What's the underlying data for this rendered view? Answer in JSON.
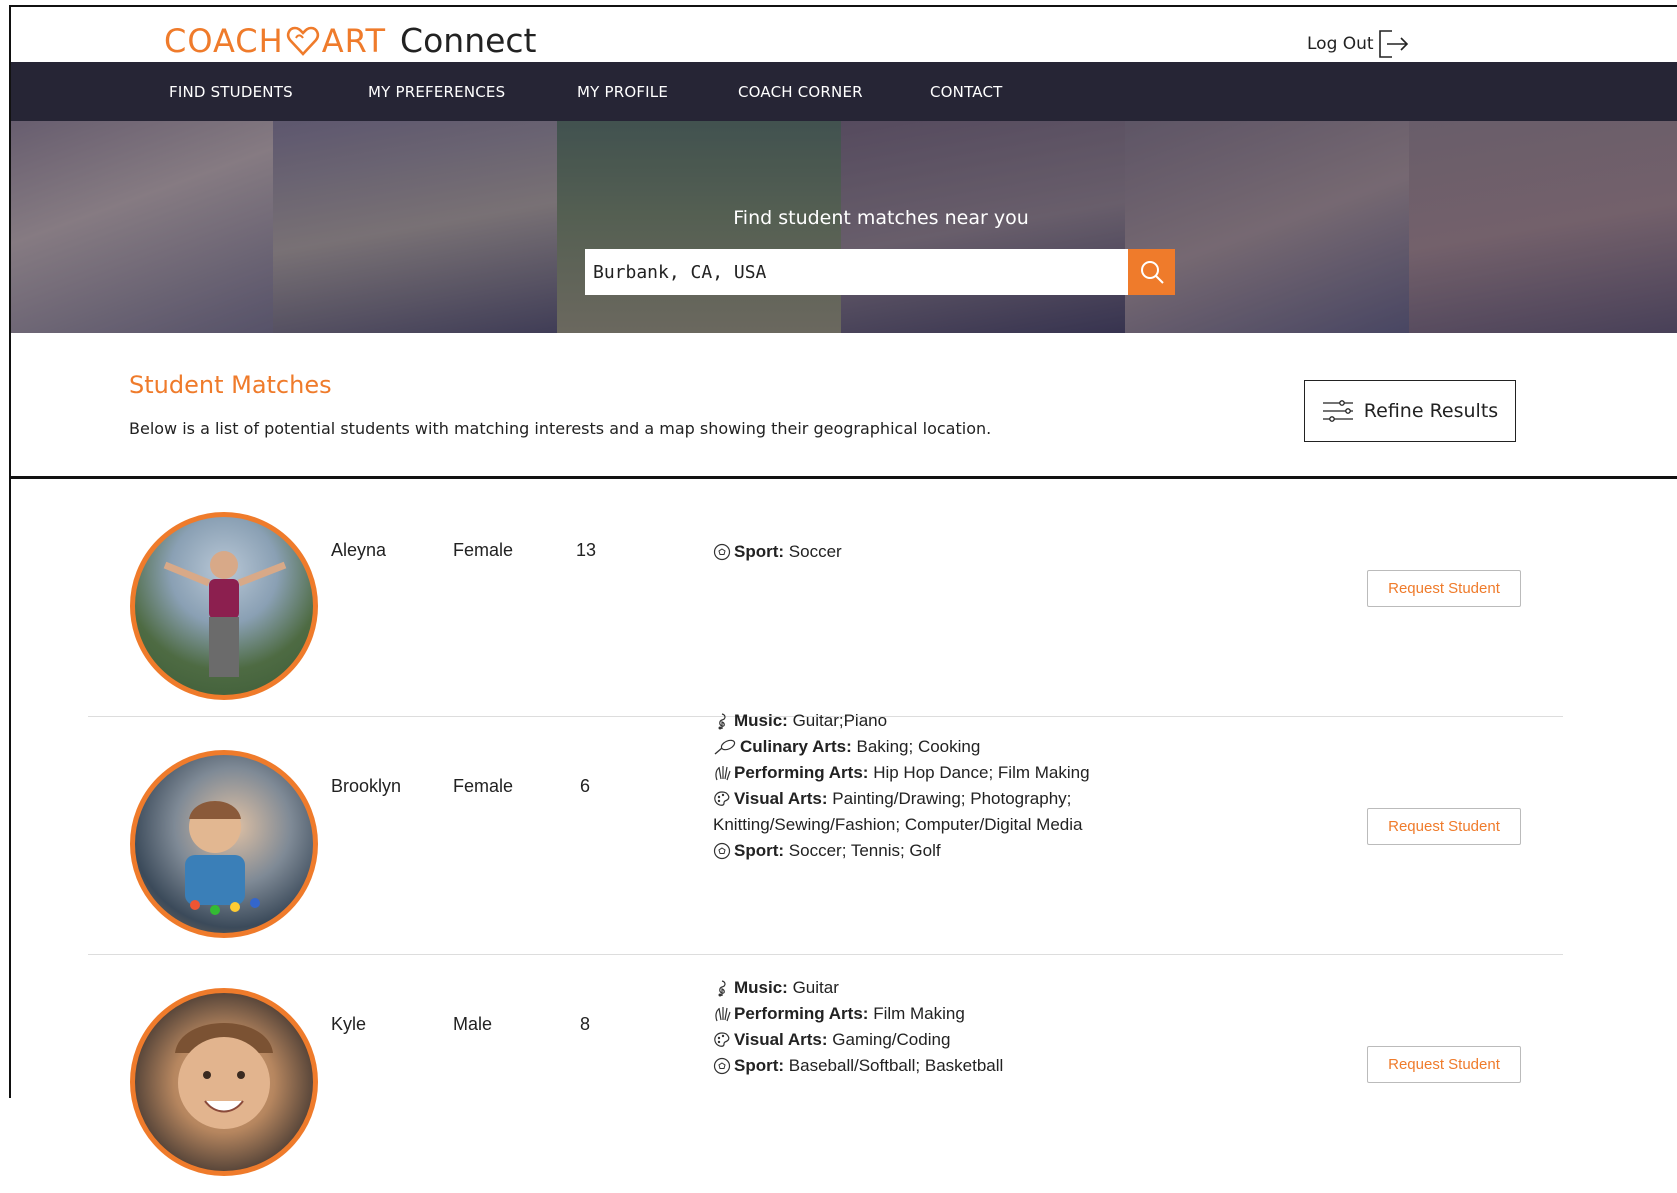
{
  "brand": {
    "logo_left": "COACH",
    "logo_right": "ART",
    "product": "Connect",
    "accent_color": "#ef7b2b",
    "nav_bg": "#262535"
  },
  "header": {
    "logout_label": "Log Out",
    "logout_icon": "logout-icon"
  },
  "nav": {
    "items": [
      {
        "label": "FIND STUDENTS"
      },
      {
        "label": "MY PREFERENCES"
      },
      {
        "label": "MY PROFILE"
      },
      {
        "label": "COACH CORNER"
      },
      {
        "label": "CONTACT"
      }
    ]
  },
  "hero": {
    "title": "Find student matches near you",
    "search_value": "Burbank, CA, USA",
    "search_icon": "search-icon"
  },
  "matches": {
    "title": "Student Matches",
    "description": "Below is a list of potential students with matching interests and a map showing their geographical location.",
    "refine_label": "Refine Results",
    "refine_icon": "sliders-icon"
  },
  "students": [
    {
      "name": "Aleyna",
      "gender": "Female",
      "age": "13",
      "request_label": "Request Student",
      "interests": [
        {
          "icon": "soccer-ball-icon",
          "category": "Sport:",
          "items": "Soccer"
        }
      ]
    },
    {
      "name": "Brooklyn",
      "gender": "Female",
      "age": "6",
      "request_label": "Request Student",
      "interests": [
        {
          "icon": "music-note-icon",
          "category": "Music:",
          "items": "Guitar;Piano"
        },
        {
          "icon": "whisk-icon",
          "category": "Culinary Arts:",
          "items": "Baking; Cooking"
        },
        {
          "icon": "jazz-hands-icon",
          "category": "Performing Arts:",
          "items": "Hip Hop Dance; Film Making"
        },
        {
          "icon": "palette-icon",
          "category": "Visual Arts:",
          "items": "Painting/Drawing; Photography;",
          "cont": "Knitting/Sewing/Fashion; Computer/Digital Media"
        },
        {
          "icon": "soccer-ball-icon",
          "category": "Sport:",
          "items": "Soccer; Tennis; Golf"
        }
      ]
    },
    {
      "name": "Kyle",
      "gender": "Male",
      "age": "8",
      "request_label": "Request Student",
      "interests": [
        {
          "icon": "music-note-icon",
          "category": "Music:",
          "items": "Guitar"
        },
        {
          "icon": "jazz-hands-icon",
          "category": "Performing Arts:",
          "items": "Film Making"
        },
        {
          "icon": "palette-icon",
          "category": "Visual Arts:",
          "items": "Gaming/Coding"
        },
        {
          "icon": "soccer-ball-icon",
          "category": "Sport:",
          "items": "Baseball/Softball; Basketball"
        }
      ]
    }
  ]
}
